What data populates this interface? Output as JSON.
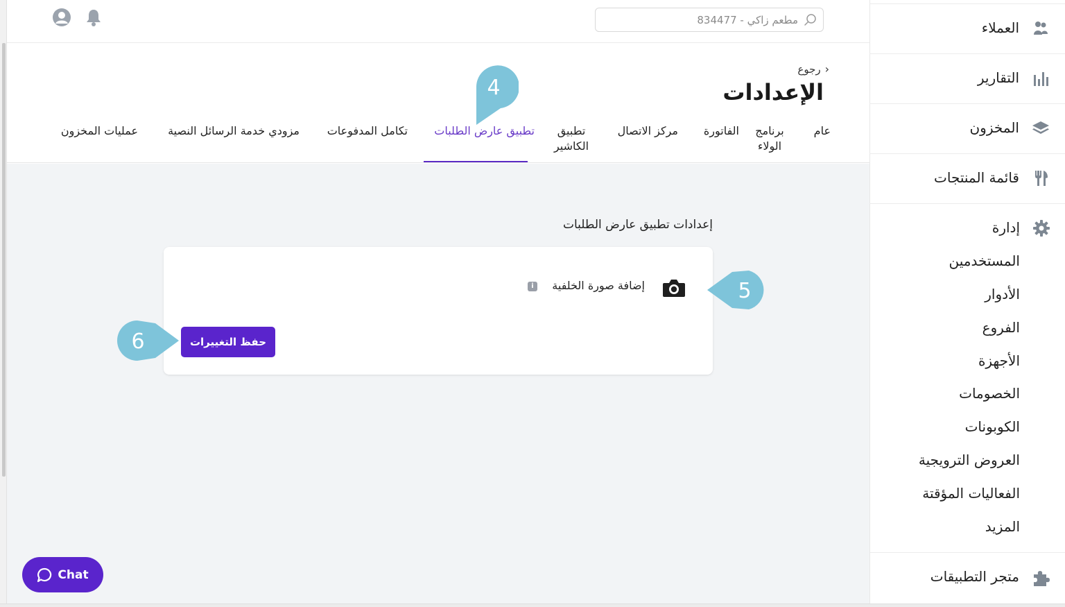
{
  "header": {
    "search_placeholder": "مطعم زاكي - 834477",
    "icons": [
      "search-icon",
      "bell-icon",
      "user-account-icon"
    ]
  },
  "page": {
    "back_label": "رجوع",
    "title": "الإعدادات",
    "tabs": [
      {
        "label": "عام"
      },
      {
        "label": "برنامج الولاء"
      },
      {
        "label": "الفاتورة"
      },
      {
        "label": "مركز الاتصال"
      },
      {
        "label": "تطبيق الكاشير"
      },
      {
        "label": "تطبيق عارض الطلبات",
        "active": true
      },
      {
        "label": "تكامل المدفوعات"
      },
      {
        "label": "مزودي خدمة الرسائل النصية"
      },
      {
        "label": "عمليات المخزون"
      }
    ]
  },
  "settings": {
    "section_title": "إعدادات تطبيق عارض الطلبات",
    "background_label": "إضافة صورة الخلفية",
    "info_icon": "i",
    "save_label": "حفظ التغييرات"
  },
  "callouts": [
    "4",
    "5",
    "6"
  ],
  "chat": {
    "label": "Chat"
  },
  "sidebar": {
    "items": [
      {
        "label": "العملاء",
        "icon": "customers-icon"
      },
      {
        "label": "التقارير",
        "icon": "bar-chart-icon"
      },
      {
        "label": "المخزون",
        "icon": "layers-icon"
      },
      {
        "label": "قائمة المنتجات",
        "icon": "fork-knife-icon"
      }
    ],
    "admin": {
      "label": "إدارة",
      "icon": "gear-icon",
      "subitems": [
        "المستخدمين",
        "الأدوار",
        "الفروع",
        "الأجهزة",
        "الخصومات",
        "الكوبونات",
        "العروض الترويجية",
        "الفعاليات المؤقتة",
        "المزيد"
      ]
    },
    "marketplace": {
      "label": "متجر التطبيقات",
      "icon": "puzzle-icon"
    }
  },
  "colors": {
    "accent": "#5a24cc",
    "active_tab": "#6a3cc8",
    "callout": "#7ec4da",
    "content_bg": "#f2f4f6"
  }
}
